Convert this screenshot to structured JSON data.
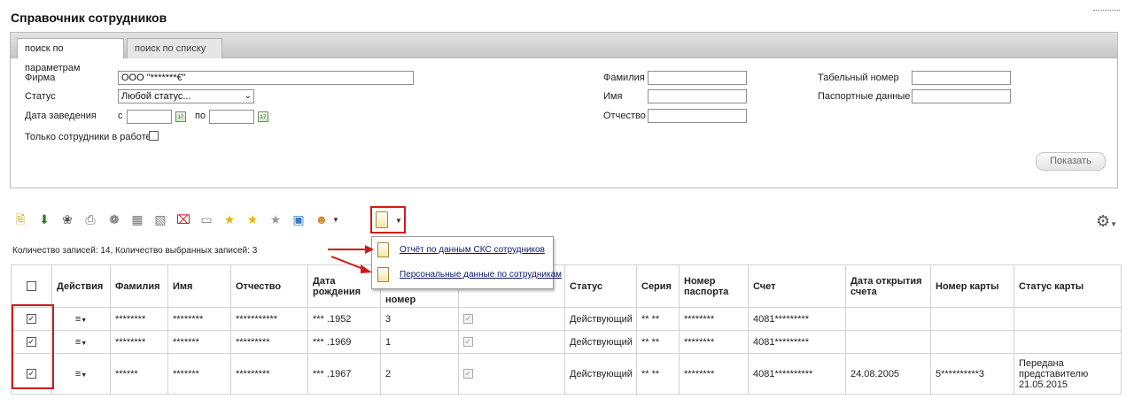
{
  "page": {
    "title": "Справочник сотрудников"
  },
  "tabs": [
    {
      "label": "поиск по параметрам"
    },
    {
      "label": "поиск по списку"
    }
  ],
  "search": {
    "firm_label": "Фирма",
    "firm_value": "ООО \"*******€\"",
    "status_label": "Статус",
    "status_value": "Любой статус...",
    "date_label": "Дата заведения",
    "date_from_label": "с",
    "date_to_label": "по",
    "only_working_label": "Только сотрудники в работе",
    "surname_label": "Фамилия",
    "name_label": "Имя",
    "patronymic_label": "Отчество",
    "tab_number_label": "Табельный номер",
    "passport_label": "Паспортные данные",
    "show_button": "Показать"
  },
  "records": {
    "summary": "Количество записей: 14, Количество выбранных записей: 3"
  },
  "report_menu": {
    "items": [
      {
        "label": "Отчёт по данным СКС сотрудников"
      },
      {
        "label": "Персональные данные по сотрудникам"
      }
    ]
  },
  "table": {
    "headers": [
      "Действия",
      "Фамилия",
      "Имя",
      "Отчество",
      "Дата рождения",
      "номер",
      "",
      "Статус",
      "Серия",
      "Номер паспорта",
      "Счет",
      "Дата открытия счета",
      "Номер карты",
      "Статус карты"
    ],
    "rows": [
      {
        "checked": true,
        "surname": "********",
        "name": "********",
        "patronymic": "***********",
        "birth": "*** .1952",
        "number": "3",
        "flag": true,
        "status": "Действующий",
        "series": "** **",
        "passport": "********",
        "account": "4081*********",
        "open_date": "",
        "card": "",
        "card_status": ""
      },
      {
        "checked": true,
        "surname": "********",
        "name": "*******",
        "patronymic": "*********",
        "birth": "*** .1969",
        "number": "1",
        "flag": true,
        "status": "Действующий",
        "series": "** **",
        "passport": "********",
        "account": "4081*********",
        "open_date": "",
        "card": "",
        "card_status": ""
      },
      {
        "checked": true,
        "surname": "******",
        "name": "*******",
        "patronymic": "*********",
        "birth": "*** .1967",
        "number": "2",
        "flag": true,
        "status": "Действующий",
        "series": "** **",
        "passport": "********",
        "account": "4081**********",
        "open_date": "24.08.2005",
        "card": "5**********3",
        "card_status": "Передана представителю 21.05.2015"
      }
    ]
  },
  "colors": {
    "highlight_red": "#d0191a",
    "panel_header": "#c7c7c7"
  }
}
